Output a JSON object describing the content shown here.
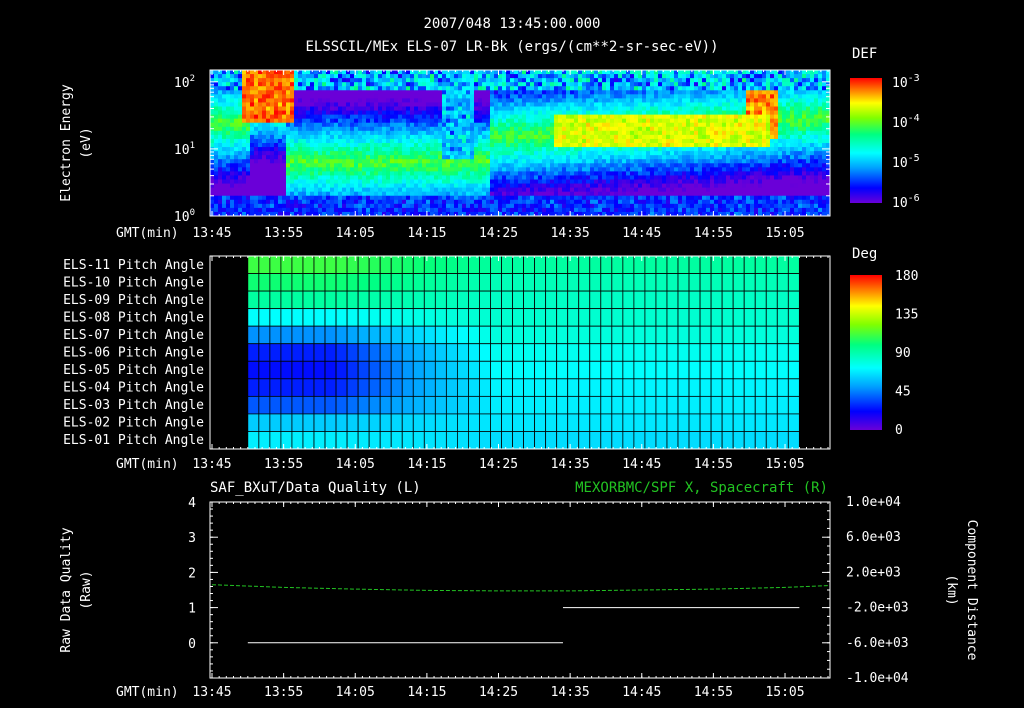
{
  "header": {
    "timestamp": "2007/048 13:45:00.000",
    "subtitle": "ELSSCIL/MEx ELS-07 LR-Bk  (ergs/(cm**2-sr-sec-eV))"
  },
  "time_axis": {
    "gmt_label": "GMT(min)",
    "ticks": [
      "13:45",
      "13:55",
      "14:05",
      "14:15",
      "14:25",
      "14:35",
      "14:45",
      "14:55",
      "15:05"
    ]
  },
  "colors": {
    "background": "#000000",
    "foreground": "#ffffff",
    "green_line": "#22c322",
    "scale": [
      "#6a00d8",
      "#0000ff",
      "#00a0ff",
      "#00ffff",
      "#00ff80",
      "#80ff00",
      "#ffff00",
      "#ff8000",
      "#ff0000"
    ]
  },
  "chart_data": [
    {
      "type": "heatmap",
      "ylabel_line1": "Electron Energy",
      "ylabel_line2": "(eV)",
      "y_scale": "log",
      "ylim": [
        1,
        150
      ],
      "y_ticks": [
        {
          "v": 1,
          "base": "10",
          "exp": "0"
        },
        {
          "v": 10,
          "base": "10",
          "exp": "1"
        },
        {
          "v": 100,
          "base": "10",
          "exp": "2"
        }
      ],
      "colorbar": {
        "label": "DEF",
        "ticks": [
          {
            "base": "10",
            "exp": "-3"
          },
          {
            "base": "10",
            "exp": "-4"
          },
          {
            "base": "10",
            "exp": "-5"
          },
          {
            "base": "10",
            "exp": "-6"
          }
        ]
      }
    },
    {
      "type": "heatmap",
      "rows": [
        "ELS-11 Pitch Angle",
        "ELS-10 Pitch Angle",
        "ELS-09 Pitch Angle",
        "ELS-08 Pitch Angle",
        "ELS-07 Pitch Angle",
        "ELS-06 Pitch Angle",
        "ELS-05 Pitch Angle",
        "ELS-04 Pitch Angle",
        "ELS-03 Pitch Angle",
        "ELS-02 Pitch Angle",
        "ELS-01 Pitch Angle"
      ],
      "data_start": "13:50",
      "data_end": "15:07",
      "row_values_start": [
        105,
        95,
        85,
        65,
        35,
        15,
        12,
        15,
        25,
        50,
        60
      ],
      "row_values_end": [
        85,
        80,
        77,
        75,
        72,
        68,
        65,
        62,
        60,
        58,
        55
      ],
      "colorbar": {
        "label": "Deg",
        "ticks": [
          "180",
          "135",
          "90",
          "45",
          "0"
        ]
      }
    },
    {
      "type": "line",
      "left_title": "SAF_BXuT/Data Quality (L)",
      "right_title": "MEXORBMC/SPF X, Spacecraft (R)",
      "ylabel_left_line1": "Raw Data Quality",
      "ylabel_left_line2": "(Raw)",
      "ylabel_right_line1": "Component Distance",
      "ylabel_right_line2": "(km)",
      "ylim_left": [
        -1,
        4
      ],
      "y_ticks_left": [
        "4",
        "3",
        "2",
        "1",
        "0"
      ],
      "ylim_right": [
        -10000,
        10000
      ],
      "y_ticks_right": [
        "1.0e+04",
        "6.0e+03",
        "2.0e+03",
        "-2.0e+03",
        "-6.0e+03",
        "-1.0e+04"
      ],
      "series": [
        {
          "axis": "left",
          "color": "white",
          "segments": [
            {
              "x": [
                "13:50",
                "14:34"
              ],
              "y": [
                0,
                0
              ]
            },
            {
              "x": [
                "14:34",
                "15:07"
              ],
              "y": [
                1,
                1
              ]
            }
          ]
        },
        {
          "axis": "right",
          "color": "green",
          "x": [
            "13:45",
            "13:55",
            "14:05",
            "14:15",
            "14:25",
            "14:35",
            "14:45",
            "14:55",
            "15:05",
            "15:11"
          ],
          "y": [
            600,
            300,
            100,
            -50,
            -100,
            -100,
            0,
            100,
            300,
            500
          ]
        }
      ]
    }
  ]
}
